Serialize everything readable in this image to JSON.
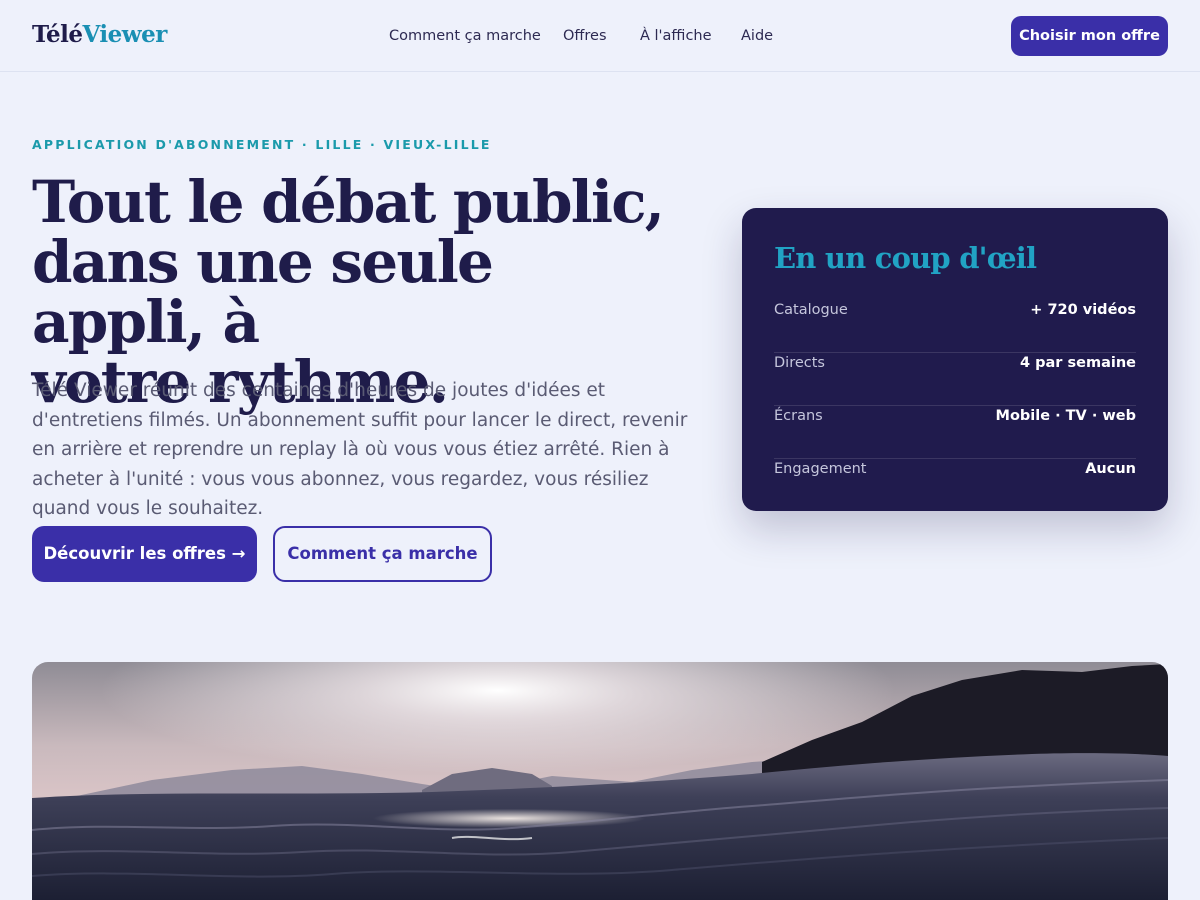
{
  "header": {
    "logo": {
      "part1": "Télé",
      "part2": "Viewer"
    },
    "nav": [
      {
        "label": "Comment ça marche"
      },
      {
        "label": "Offres"
      },
      {
        "label": "À l'affiche"
      },
      {
        "label": "Aide"
      }
    ],
    "cta_label": "Choisir mon offre"
  },
  "hero": {
    "eyebrow": "APPLICATION D'ABONNEMENT · LILLE · VIEUX-LILLE",
    "title_lines": [
      "Tout le débat public,",
      "dans une seule appli, à",
      "votre rythme."
    ],
    "lead": "Télé Viewer réunit des centaines d'heures de joutes d'idées et d'entretiens filmés. Un abonnement suffit pour lancer le direct, revenir en arrière et reprendre un replay là où vous vous étiez arrêté. Rien à acheter à l'unité : vous vous abonnez, vous regardez, vous résiliez quand vous le souhaitez.",
    "primary_button": "Découvrir les offres →",
    "secondary_button": "Comment ça marche"
  },
  "glance": {
    "title": "En un coup d'œil",
    "rows": [
      {
        "key": "Catalogue",
        "value": "+ 720 vidéos"
      },
      {
        "key": "Directs",
        "value": "4 par semaine"
      },
      {
        "key": "Écrans",
        "value": "Mobile · TV · web"
      },
      {
        "key": "Engagement",
        "value": "Aucun"
      }
    ]
  },
  "colors": {
    "background": "#eef1fb",
    "primary": "#3a2fa8",
    "navy": "#1f1c4a",
    "accent_teal": "#1a8fb3",
    "card_bg": "#201b4d"
  }
}
